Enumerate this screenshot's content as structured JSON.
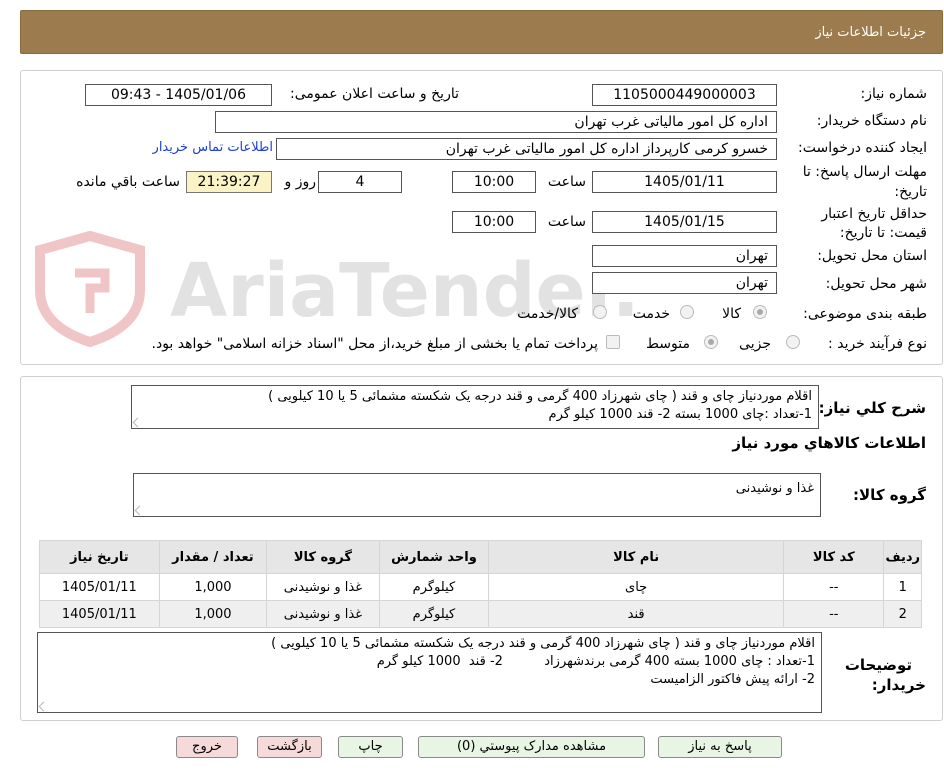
{
  "header": {
    "title": "جزئیات اطلاعات نیاز"
  },
  "watermark": {
    "text": "AriaTender.neT"
  },
  "form": {
    "need_number_label": "شماره نیاز:",
    "need_number": "1105000449000003",
    "announce_label": "تاریخ و ساعت اعلان عمومی:",
    "announce_value": "1405/01/06 - 09:43",
    "buyer_org_label": "نام دستگاه خریدار:",
    "buyer_org": "اداره کل امور مالیاتی غرب تهران",
    "requester_label": "ایجاد کننده درخواست:",
    "requester": "خسرو کرمی کارپرداز اداره کل امور مالیاتی غرب تهران",
    "contact_link": "اطلاعات تماس خریدار",
    "deadline_label_1": "مهلت ارسال پاسخ: تا",
    "deadline_label_2": "تاریخ:",
    "deadline_date": "1405/01/11",
    "time_label": "ساعت",
    "deadline_time": "10:00",
    "days_value": "4",
    "days_label": "روز و",
    "remaining_time": "21:39:27",
    "remaining_label": "ساعت باقي مانده",
    "validity_label_1": "حداقل تاریخ اعتبار",
    "validity_label_2": "قیمت: تا تاریخ:",
    "validity_date": "1405/01/15",
    "validity_time": "10:00",
    "province_label": "استان محل تحویل:",
    "province": "تهران",
    "city_label": "شهر محل تحویل:",
    "city": "تهران",
    "category_label": "طبقه بندی موضوعی:",
    "category_options": [
      "کالا",
      "خدمت",
      "کالا/خدمت"
    ],
    "category_selected": "کالا",
    "purchase_type_label": "نوع فرآیند خرید :",
    "purchase_options": [
      "جزیی",
      "متوسط"
    ],
    "purchase_selected": "متوسط",
    "payment_note": "پرداخت تمام یا بخشی از مبلغ خرید،از محل \"اسناد خزانه اسلامی\" خواهد بود."
  },
  "summary": {
    "label": "شرح کلي نياز:",
    "line1": "اقلام موردنیاز چای و قند   ( چای شهرزاد 400 گرمی  و قند درجه یک شکسته مشمائی 5 یا 10 کیلویی )",
    "line2": "1-تعداد :چای 1000 بسته   2- قند  1000 کیلو گرم"
  },
  "goods_info_title": "اطلاعات کالاهاي مورد نياز",
  "goods_group": {
    "label": "گروه کالا:",
    "value": "غذا و نوشیدنی"
  },
  "table": {
    "headers": [
      "ردیف",
      "کد کالا",
      "نام کالا",
      "واحد شمارش",
      "گروه کالا",
      "تعداد / مقدار",
      "تاریخ نیاز"
    ],
    "rows": [
      [
        "1",
        "--",
        "چای",
        "کیلوگرم",
        "غذا و نوشیدنی",
        "1,000",
        "1405/01/11"
      ],
      [
        "2",
        "--",
        "قند",
        "کیلوگرم",
        "غذا و نوشیدنی",
        "1,000",
        "1405/01/11"
      ]
    ]
  },
  "buyer_notes": {
    "label_1": "توضیحات",
    "label_2": "خریدار:",
    "line1": "اقلام موردنیاز چای و قند   ( چای شهرزاد 400 گرمی  و قند درجه یک شکسته مشمائی 5 یا 10 کیلویی )",
    "line2": "1-تعداد : چای 1000 بسته 400 گرمی برندشهرزاد          2- قند  1000 کیلو گرم",
    "line3": "2- ارائه پیش فاکتور الزامیست"
  },
  "buttons": {
    "reply": "پاسخ به نیاز",
    "attachments": "مشاهده مدارک پیوستي (0)",
    "print": "چاپ",
    "back": "بازگشت",
    "exit": "خروج"
  }
}
